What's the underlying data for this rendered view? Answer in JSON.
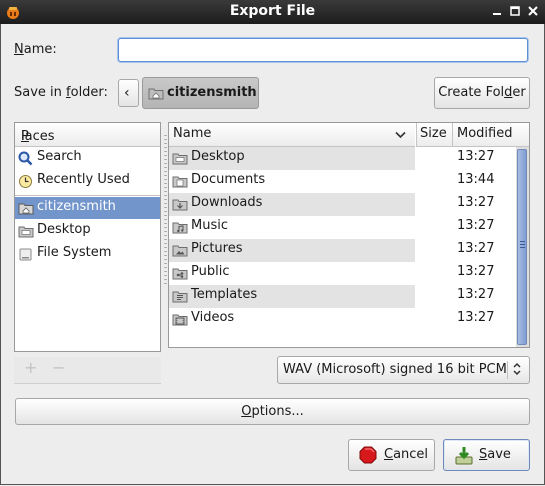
{
  "window": {
    "title": "Export File",
    "controls": [
      "minimize-icon",
      "maximize-icon",
      "close-icon"
    ]
  },
  "name_row": {
    "label": "Name:",
    "label_mnemonic": "N",
    "label_rest": "ame:",
    "value": ""
  },
  "folder_row": {
    "label_pre": "Save in ",
    "label_mnemonic": "f",
    "label_post": "older:",
    "back_glyph": "‹",
    "current_folder": "citizensmith",
    "create_folder_label": "Create Folder",
    "create_folder_pre": "Create Fol",
    "create_folder_mnemonic": "d",
    "create_folder_post": "er"
  },
  "places": {
    "header": "Places",
    "header_mnemonic": "P",
    "header_rest": "laces",
    "items": [
      {
        "label": "Search",
        "icon": "search-icon"
      },
      {
        "label": "Recently Used",
        "icon": "clock-icon"
      },
      {
        "label": "citizensmith",
        "icon": "home-folder-icon",
        "selected": true
      },
      {
        "label": "Desktop",
        "icon": "folder-icon"
      },
      {
        "label": "File System",
        "icon": "drive-icon"
      }
    ],
    "add_glyph": "+",
    "remove_glyph": "−"
  },
  "files": {
    "columns": {
      "name": "Name",
      "size": "Size",
      "modified": "Modified"
    },
    "rows": [
      {
        "name": "Desktop",
        "size": "",
        "modified": "13:27"
      },
      {
        "name": "Documents",
        "size": "",
        "modified": "13:44"
      },
      {
        "name": "Downloads",
        "size": "",
        "modified": "13:27"
      },
      {
        "name": "Music",
        "size": "",
        "modified": "13:27"
      },
      {
        "name": "Pictures",
        "size": "",
        "modified": "13:27"
      },
      {
        "name": "Public",
        "size": "",
        "modified": "13:27"
      },
      {
        "name": "Templates",
        "size": "",
        "modified": "13:27"
      },
      {
        "name": "Videos",
        "size": "",
        "modified": "13:27"
      }
    ]
  },
  "format": {
    "selected": "WAV (Microsoft) signed 16 bit PCM"
  },
  "options": {
    "label": "Options...",
    "mnemonic": "O",
    "rest": "ptions..."
  },
  "buttons": {
    "cancel": {
      "label": "Cancel",
      "mnemonic": "C",
      "rest": "ancel"
    },
    "save": {
      "label": "Save",
      "mnemonic": "S",
      "rest": "ave"
    }
  },
  "colors": {
    "selection": "#7295cb",
    "focus": "#5b8fd2",
    "titlebar": "#1c1c1c"
  }
}
